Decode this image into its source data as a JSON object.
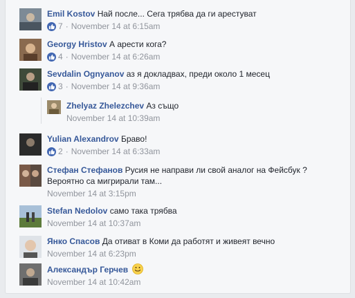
{
  "comments": [
    {
      "author": "Emil Kostov",
      "text": "Най после... Сега трябва да ги арестуват",
      "likes": "7",
      "date": "November 14 at 6:15am"
    },
    {
      "author": "Georgy Hristov",
      "text": "А арести кога?",
      "likes": "4",
      "date": "November 14 at 6:26am"
    },
    {
      "author": "Sevdalin Ognyanov",
      "text": "аз я докладвах, преди около 1 месец",
      "likes": "3",
      "date": "November 14 at 9:36am"
    },
    {
      "author": "Zhelyaz Zhelezchev",
      "text": "Аз също",
      "date": "November 14 at 10:39am"
    },
    {
      "author": "Yulian Alexandrov",
      "text": "Браво!",
      "likes": "2",
      "date": "November 14 at 6:33am"
    },
    {
      "author": "Стефан Стефанов",
      "text": "Русия не направи ли свой аналог на Фейсбук ?",
      "text2": "Вероятно са мигрирали там...",
      "date": "November 14 at 3:15pm"
    },
    {
      "author": "Stefan Nedolov",
      "text": "само така трябва",
      "date": "November 14 at 10:37am"
    },
    {
      "author": "Янко Спасов",
      "text": "Да отиват в Коми да работят и живеят вечно",
      "date": "November 14 at 6:23pm"
    },
    {
      "author": "Александър Герчев",
      "date": "November 14 at 10:42am"
    }
  ],
  "meta": {
    "separator": "·"
  },
  "colors": {
    "link": "#365899",
    "meta": "#90949c",
    "like": "#4267b2",
    "background": "#e9ebee",
    "panel": "#f6f7f9"
  },
  "icons": [
    "like-thumb-icon",
    "smiley-emoji-icon"
  ]
}
